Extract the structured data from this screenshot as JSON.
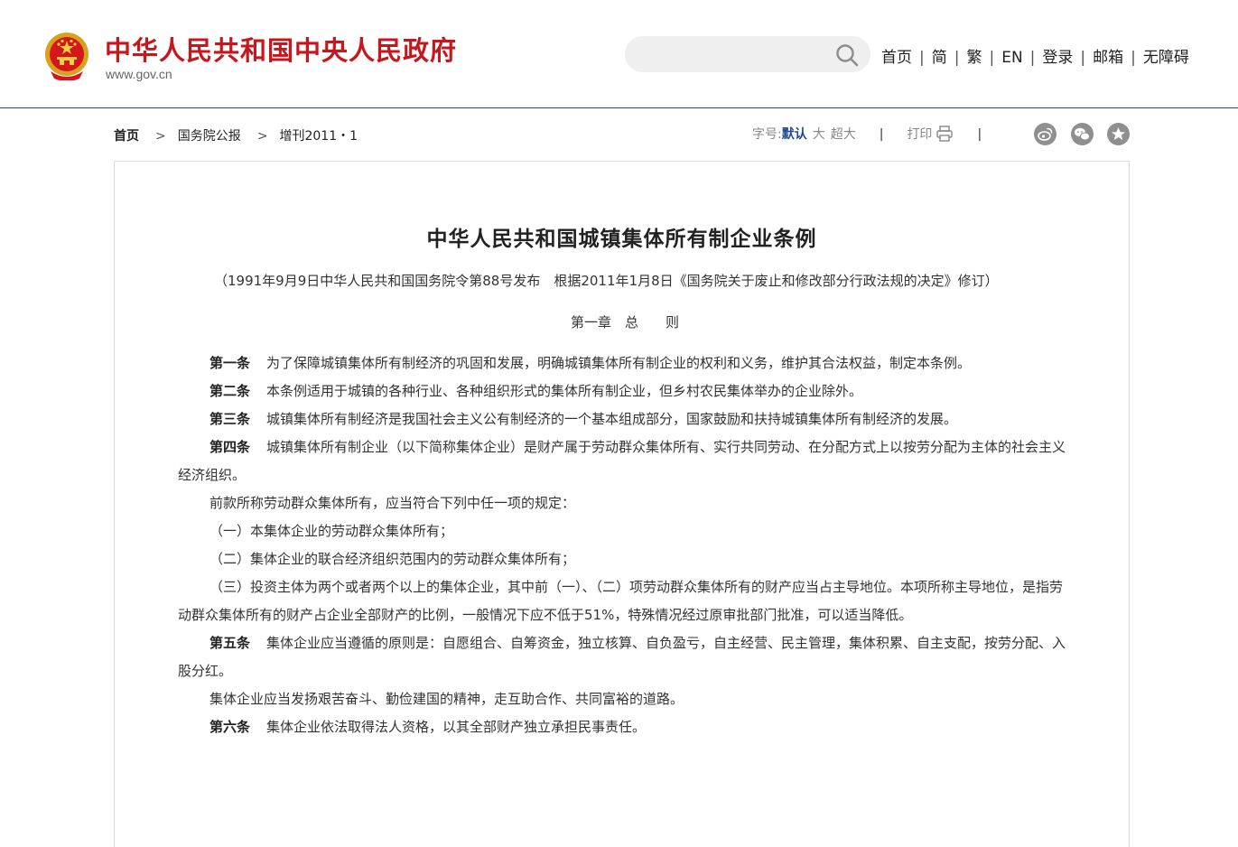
{
  "header": {
    "site_title": "中华人民共和国中央人民政府",
    "site_url": "www.gov.cn",
    "search": {
      "value": "",
      "placeholder": ""
    },
    "nav": [
      "首页",
      "简",
      "繁",
      "EN",
      "登录",
      "邮箱",
      "无障碍"
    ]
  },
  "breadcrumb": [
    "首页",
    "国务院公报",
    "增刊2011・1"
  ],
  "tools": {
    "font_label": "字号:",
    "font_default": "默认",
    "font_large": "大",
    "font_xlarge": "超大",
    "separator": "|",
    "print_label": "打印"
  },
  "share_icons": [
    "weibo-icon",
    "wechat-icon",
    "favorite-icon"
  ],
  "article": {
    "title": "中华人民共和国城镇集体所有制企业条例",
    "note": "（1991年9月9日中华人民共和国国务院令第88号发布　根据2011年1月8日《国务院关于废止和修改部分行政法规的决定》修订）",
    "chapter": "第一章　总　　则",
    "art1_label": "第一条",
    "art1": "为了保障城镇集体所有制经济的巩固和发展，明确城镇集体所有制企业的权利和义务，维护其合法权益，制定本条例。",
    "art2_label": "第二条",
    "art2": "本条例适用于城镇的各种行业、各种组织形式的集体所有制企业，但乡村农民集体举办的企业除外。",
    "art3_label": "第三条",
    "art3": "城镇集体所有制经济是我国社会主义公有制经济的一个基本组成部分，国家鼓励和扶持城镇集体所有制经济的发展。",
    "art4_label": "第四条",
    "art4": "城镇集体所有制企业（以下简称集体企业）是财产属于劳动群众集体所有、实行共同劳动、在分配方式上以按劳分配为主体的社会主义经济组织。",
    "p4a": "前款所称劳动群众集体所有，应当符合下列中任一项的规定：",
    "p4b": "（一）本集体企业的劳动群众集体所有；",
    "p4c": "（二）集体企业的联合经济组织范围内的劳动群众集体所有；",
    "p4d": "（三）投资主体为两个或者两个以上的集体企业，其中前（一）、（二）项劳动群众集体所有的财产应当占主导地位。本项所称主导地位，是指劳动群众集体所有的财产占企业全部财产的比例，一般情况下应不低于51%，特殊情况经过原审批部门批准，可以适当降低。",
    "art5_label": "第五条",
    "art5": "集体企业应当遵循的原则是：自愿组合、自筹资金，独立核算、自负盈亏，自主经营、民主管理，集体积累、自主支配，按劳分配、入股分红。",
    "p5a": "集体企业应当发扬艰苦奋斗、勤俭建国的精神，走互助合作、共同富裕的道路。",
    "art6_label": "第六条",
    "art6": "集体企业依法取得法人资格，以其全部财产独立承担民事责任。"
  }
}
